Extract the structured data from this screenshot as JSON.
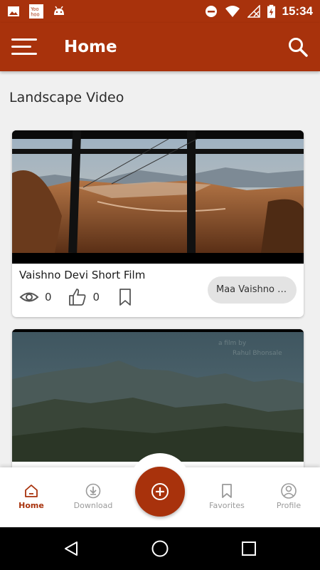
{
  "status_bar": {
    "time": "15:34",
    "left_icons": [
      "image-icon",
      "yoohoo-icon",
      "android-icon"
    ],
    "right_icons": [
      "dnd-icon",
      "wifi-icon",
      "no-signal-icon",
      "battery-charging-icon"
    ]
  },
  "app_bar": {
    "title": "Home",
    "menu_icon": "hamburger-icon",
    "search_icon": "search-icon",
    "color": "#a8320c"
  },
  "section": {
    "title": "Landscape Video"
  },
  "videos": [
    {
      "title": "Vaishno Devi  Short Film",
      "views": "0",
      "likes": "0",
      "tag": "Maa Vaishno Devi"
    },
    {
      "watermark_line1": "a film by",
      "watermark_line2": "Rahul Bhonsale"
    }
  ],
  "bottom_nav": {
    "items": [
      {
        "label": "Home",
        "icon": "home-icon",
        "active": true
      },
      {
        "label": "Download",
        "icon": "download-icon",
        "active": false
      },
      {
        "label": "Favorites",
        "icon": "bookmark-icon",
        "active": false
      },
      {
        "label": "Profile",
        "icon": "profile-icon",
        "active": false
      }
    ],
    "fab_icon": "add-circle-icon"
  },
  "system_nav": [
    "back-icon",
    "home-circle-icon",
    "recents-icon"
  ]
}
